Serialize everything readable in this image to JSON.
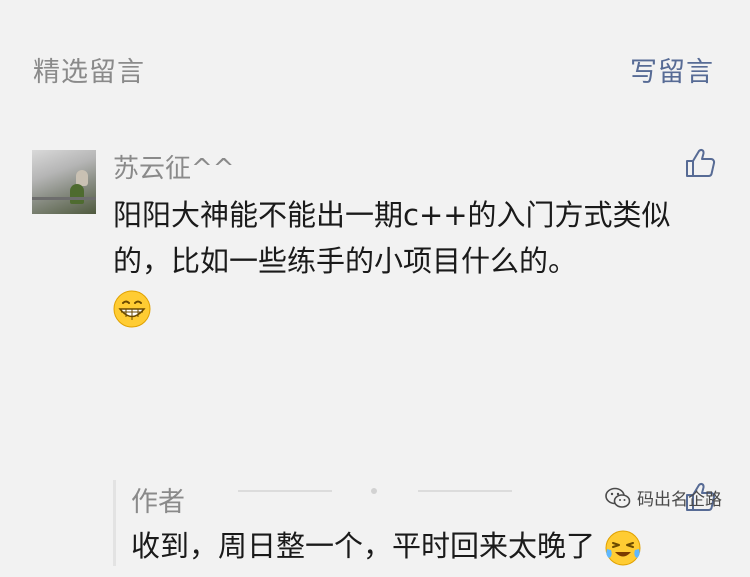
{
  "header": {
    "title": "精选留言",
    "write_label": "写留言"
  },
  "comment": {
    "nickname": "苏云征^^",
    "text": "阳阳大神能不能出一期c++的入门方式类似的，比如一些练手的小项目什么的。",
    "emoji": "grin-emoji",
    "reply": {
      "author": "作者",
      "text": "收到，周日整一个，平时回来太晚了",
      "emoji": "tears-of-joy-emoji"
    }
  },
  "footer": {
    "brand": "码出名企路"
  },
  "colors": {
    "link": "#576b95",
    "muted": "#8a8a8a",
    "text": "#1a1a1a",
    "background": "#f2f2f2"
  }
}
